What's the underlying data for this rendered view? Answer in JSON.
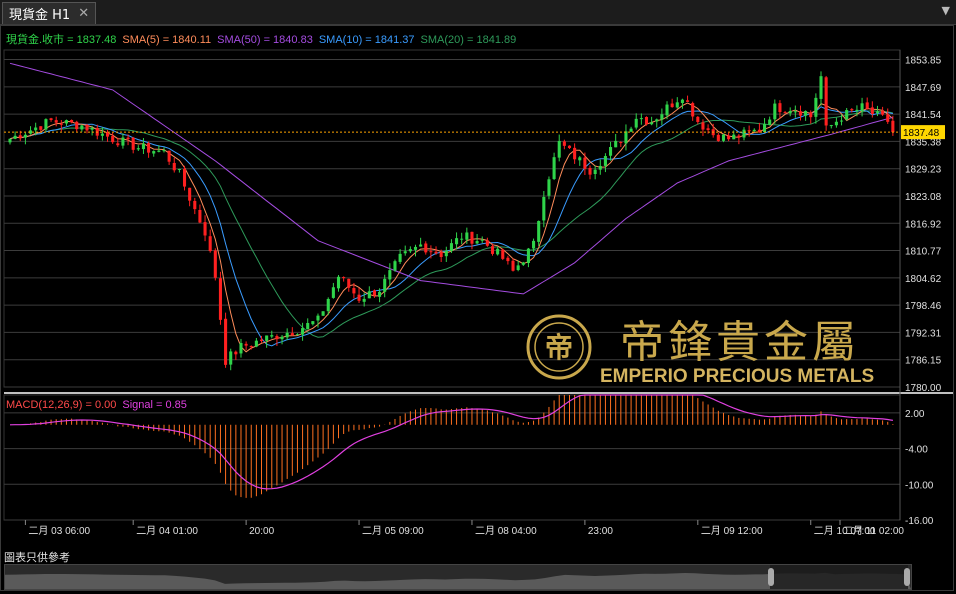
{
  "tab": {
    "title": "現貨金 H1",
    "close": "✕"
  },
  "legend_main": [
    {
      "text": "現貨金.收市 = 1837.48",
      "color": "#2fd44a"
    },
    {
      "text": "SMA(5) = 1840.11",
      "color": "#ff8c5a"
    },
    {
      "text": "SMA(50) = 1840.83",
      "color": "#a44ce0"
    },
    {
      "text": "SMA(10) = 1841.37",
      "color": "#3a9cff"
    },
    {
      "text": "SMA(20) = 1841.89",
      "color": "#2e9a5a"
    }
  ],
  "legend_macd": [
    {
      "text": "MACD(12,26,9) = 0.00",
      "color": "#ff4a4a"
    },
    {
      "text": "Signal = 0.85",
      "color": "#e040e0"
    }
  ],
  "watermark": {
    "cn": "帝鋒貴金屬",
    "en": "EMPERIO PRECIOUS METALS"
  },
  "footer": {
    "text": "圖表只供參考"
  },
  "colors": {
    "up": "#2fd44a",
    "down": "#ff2020",
    "sma5": "#ff8c5a",
    "sma10": "#3a9cff",
    "sma20": "#2e9a5a",
    "sma50": "#a44ce0",
    "signal": "#e040e0",
    "hist": "#ff7020",
    "current": "#ffa500",
    "gold": "#c9a84c"
  },
  "chart_data": [
    {
      "type": "candlestick",
      "title": "現貨金 H1",
      "ylim": [
        1780.0,
        1856.0
      ],
      "yticks": [
        "1853.85",
        "1847.69",
        "1841.54",
        "1835.38",
        "1829.23",
        "1823.08",
        "1816.92",
        "1810.77",
        "1804.62",
        "1798.46",
        "1792.31",
        "1786.15",
        "1780.00"
      ],
      "current_price": "1837.48",
      "xtick_labels": [
        "二月 03 06:00",
        "二月 04 01:00",
        "20:00",
        "二月 05 09:00",
        "二月 08 04:00",
        "23:00",
        "二月 09 12:00",
        "二月 10 07:00",
        "二月 11 02:00"
      ],
      "anchors": [
        [
          0,
          1836
        ],
        [
          8,
          1840
        ],
        [
          14,
          1839
        ],
        [
          20,
          1836
        ],
        [
          25,
          1834
        ],
        [
          30,
          1833
        ],
        [
          33,
          1828
        ],
        [
          36,
          1820
        ],
        [
          38,
          1815
        ],
        [
          40,
          1805
        ],
        [
          42,
          1786
        ],
        [
          45,
          1789
        ],
        [
          50,
          1791
        ],
        [
          56,
          1793
        ],
        [
          60,
          1795
        ],
        [
          64,
          1805
        ],
        [
          68,
          1800
        ],
        [
          72,
          1802
        ],
        [
          76,
          1809
        ],
        [
          80,
          1812
        ],
        [
          84,
          1810
        ],
        [
          88,
          1814
        ],
        [
          92,
          1813
        ],
        [
          96,
          1809
        ],
        [
          98,
          1806
        ],
        [
          102,
          1812
        ],
        [
          104,
          1824
        ],
        [
          107,
          1835
        ],
        [
          110,
          1832
        ],
        [
          113,
          1829
        ],
        [
          116,
          1832
        ],
        [
          119,
          1836
        ],
        [
          122,
          1841
        ],
        [
          125,
          1840
        ],
        [
          128,
          1843
        ],
        [
          131,
          1846
        ],
        [
          134,
          1840
        ],
        [
          137,
          1837
        ],
        [
          140,
          1836
        ],
        [
          143,
          1837
        ],
        [
          146,
          1838
        ],
        [
          149,
          1843
        ],
        [
          152,
          1843
        ],
        [
          155,
          1842
        ],
        [
          156,
          1841
        ],
        [
          158,
          1850
        ],
        [
          159,
          1838
        ],
        [
          162,
          1841
        ],
        [
          166,
          1843
        ],
        [
          169,
          1841
        ],
        [
          171,
          1840
        ],
        [
          172,
          1837.48
        ]
      ],
      "sma50_points": [
        [
          0,
          1853
        ],
        [
          20,
          1847
        ],
        [
          40,
          1831
        ],
        [
          60,
          1813
        ],
        [
          80,
          1804
        ],
        [
          100,
          1801
        ],
        [
          110,
          1808
        ],
        [
          120,
          1818
        ],
        [
          130,
          1826
        ],
        [
          140,
          1831
        ],
        [
          150,
          1834
        ],
        [
          160,
          1837
        ],
        [
          172,
          1840.83
        ]
      ],
      "final": {
        "close": 1837.48,
        "sma5": 1840.11,
        "sma10": 1841.37,
        "sma20": 1841.89,
        "sma50": 1840.83
      }
    },
    {
      "type": "macd",
      "ylim": [
        -16.0,
        5.0
      ],
      "yticks": [
        "2.00",
        "-4.00",
        "-10.00",
        "-16.00"
      ],
      "values": {
        "macd": 0.0,
        "signal": 0.85
      }
    }
  ]
}
